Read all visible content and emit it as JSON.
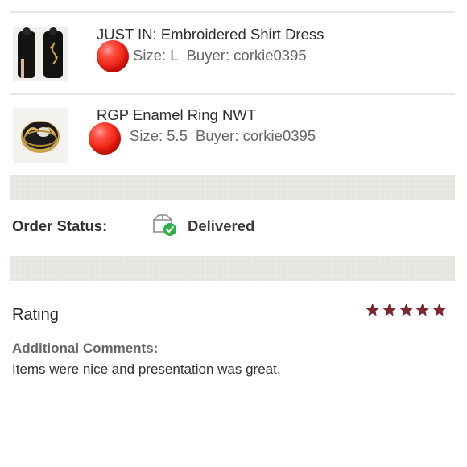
{
  "items": [
    {
      "title": "JUST IN: Embroidered Shirt Dress",
      "size": "Size: L",
      "buyer": "Buyer: corkie0395"
    },
    {
      "title": "RGP Enamel Ring NWT",
      "size": "Size: 5.5",
      "buyer": "Buyer: corkie0395"
    }
  ],
  "order_status": {
    "label": "Order Status:",
    "value": "Delivered",
    "icon": "package-delivered-icon"
  },
  "rating": {
    "label": "Rating",
    "stars": 5,
    "star_color": "#7d2630"
  },
  "comments": {
    "label": "Additional Comments:",
    "text": "Items were nice and presentation was great."
  },
  "colors": {
    "status_check": "#2db34a",
    "marker_ball": "#e8261a",
    "band": "#ebe9e4"
  }
}
